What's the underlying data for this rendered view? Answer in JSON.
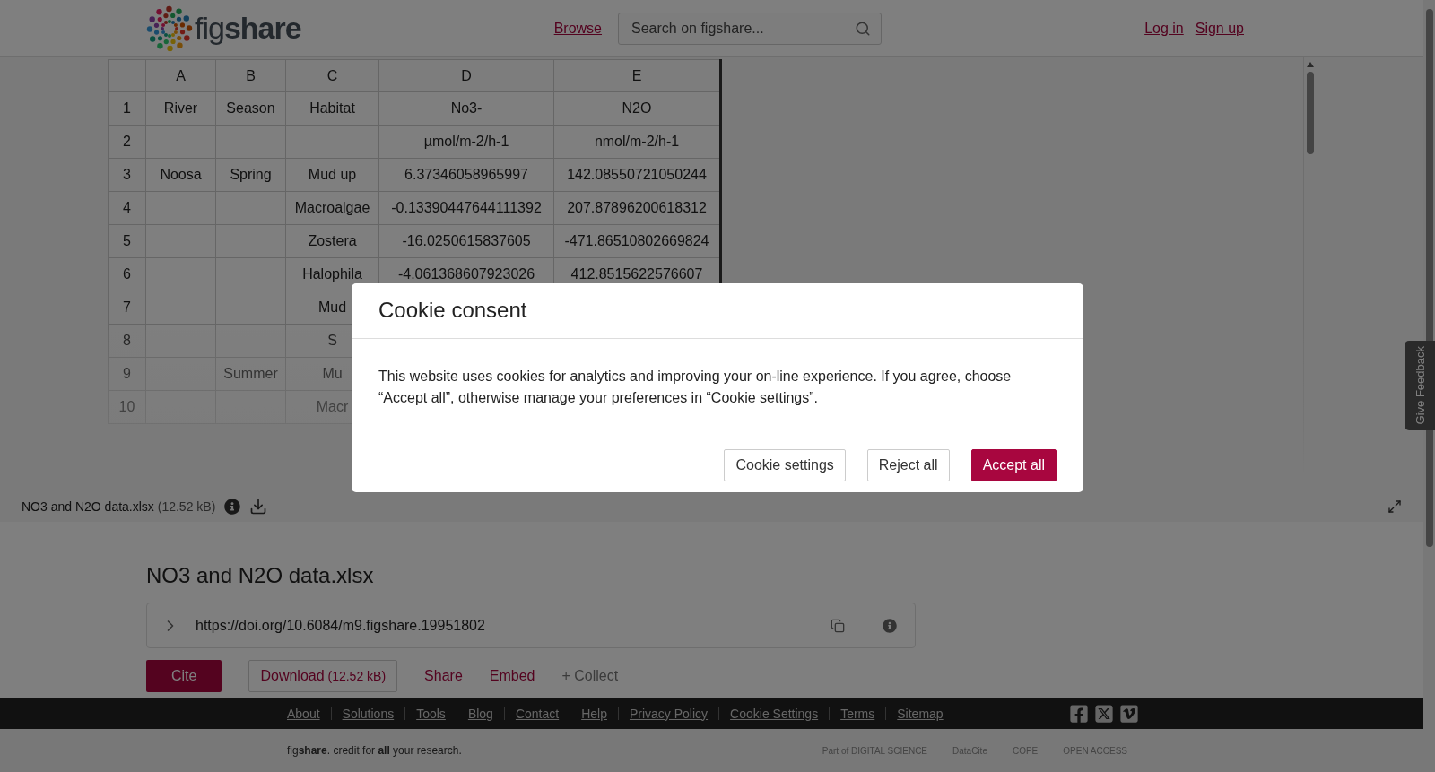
{
  "header": {
    "logo": "fig**share**",
    "nav_link": "Browse",
    "search": {
      "placeholder": "Search on figshare..."
    },
    "auth_links": [
      "Log in",
      "Sign up"
    ]
  },
  "sheet": {
    "columns": [
      "A",
      "B",
      "C",
      "D",
      "E"
    ],
    "rows": [
      {
        "number": "1",
        "cells": {
          "A": "River",
          "B": "Season",
          "C": "Habitat",
          "D": "No3-",
          "E": "N2O"
        }
      },
      {
        "number": "2",
        "cells": {
          "D": "µmol/m-2/h-1",
          "E": "nmol/m-2/h-1"
        }
      },
      {
        "number": "3",
        "cells": {
          "A": "Noosa",
          "B": "Spring",
          "C": "Mud up",
          "D": "6.37346058965997",
          "E": "142.08550721050244"
        }
      },
      {
        "number": "4",
        "cells": {
          "C": "Macroalgae",
          "D": "-0.13390447644111392",
          "E": "207.87896200618312"
        }
      },
      {
        "number": "5",
        "cells": {
          "C": "Zostera",
          "D": "-16.0250615837605",
          "E": "-471.86510802669824"
        }
      },
      {
        "number": "6",
        "cells": {
          "C": "Halophila",
          "D": "-4.061368607923026",
          "E": "412.8515622576607"
        }
      },
      {
        "number": "7",
        "cells": {
          "C": "Mud"
        }
      },
      {
        "number": "8",
        "cells": {
          "C": "S"
        }
      },
      {
        "number": "9",
        "cells": {
          "B": "Summer",
          "C": "Mu"
        }
      },
      {
        "number": "10",
        "cells": {
          "C": "Macr"
        }
      }
    ]
  },
  "file_bar": {
    "name": "NO3 and N2O data.xlsx",
    "size": "(12.52 kB)"
  },
  "feedback_tab": "Give Feedback",
  "item": {
    "title": "NO3 and N2O data.xlsx",
    "doi": "https://doi.org/10.6084/m9.figshare.19951802",
    "actions": [
      {
        "kind": "primary",
        "label": "Cite"
      },
      {
        "kind": "outline",
        "label": "Download",
        "note": "(12.52 kB)"
      },
      {
        "kind": "link",
        "label": "Share"
      },
      {
        "kind": "link",
        "label": "Embed"
      },
      {
        "kind": "muted",
        "label": "+ Collect"
      }
    ]
  },
  "footer": {
    "links": [
      "About",
      "Solutions",
      "Tools",
      "Blog",
      "Contact",
      "Help",
      "Privacy Policy",
      "Cookie Settings",
      "Terms",
      "Sitemap"
    ],
    "tagline": "fig**share**. credit for **all** your research.",
    "partners": [
      "Part of DIGITAL SCIENCE",
      "DataCite",
      "COPE",
      "OPEN ACCESS"
    ]
  },
  "cookie_dialog": {
    "title": "Cookie consent",
    "text": "This website uses cookies for analytics and improving your on-line experience. If you agree, choose “Accept all”, otherwise manage your preferences in “Cookie settings”.",
    "buttons": [
      {
        "kind": "outline",
        "label": "Cookie settings"
      },
      {
        "kind": "outline",
        "label": "Reject all"
      },
      {
        "kind": "primary",
        "label": "Accept all"
      }
    ]
  }
}
